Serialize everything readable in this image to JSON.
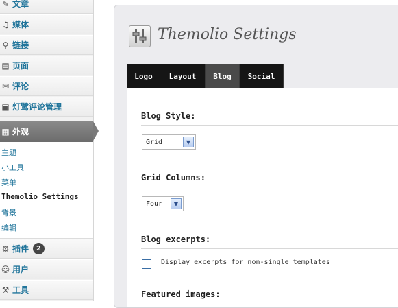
{
  "sidebar": {
    "items": [
      {
        "label": "文章",
        "icon": "pin-icon"
      },
      {
        "label": "媒体",
        "icon": "media-icon"
      },
      {
        "label": "链接",
        "icon": "link-icon"
      },
      {
        "label": "页面",
        "icon": "page-icon"
      },
      {
        "label": "评论",
        "icon": "comment-icon"
      },
      {
        "label": "灯鹭评论管理",
        "icon": "comment-manager-icon"
      },
      {
        "label": "外观",
        "icon": "appearance-icon"
      }
    ],
    "submenu": [
      "主题",
      "小工具",
      "菜单",
      "Themolio Settings",
      "背景",
      "编辑"
    ],
    "bottom_items": [
      {
        "label": "插件",
        "icon": "plugin-icon",
        "badge": "2"
      },
      {
        "label": "用户",
        "icon": "users-icon"
      },
      {
        "label": "工具",
        "icon": "tools-icon"
      }
    ]
  },
  "main": {
    "title": "Themolio Settings",
    "tabs": [
      "Logo",
      "Layout",
      "Blog",
      "Social"
    ],
    "active_tab": "Blog",
    "blog_style": {
      "heading": "Blog Style:",
      "value": "Grid"
    },
    "grid_columns": {
      "heading": "Grid Columns:",
      "value": "Four"
    },
    "blog_excerpts": {
      "heading": "Blog excerpts:",
      "checkbox_label": "Display excerpts for non-single templates"
    },
    "featured_images": {
      "heading": "Featured images:"
    }
  },
  "colors": {
    "link": "#21759b",
    "current_menu": "#7a7a7a",
    "tab_bar": "#151515"
  }
}
